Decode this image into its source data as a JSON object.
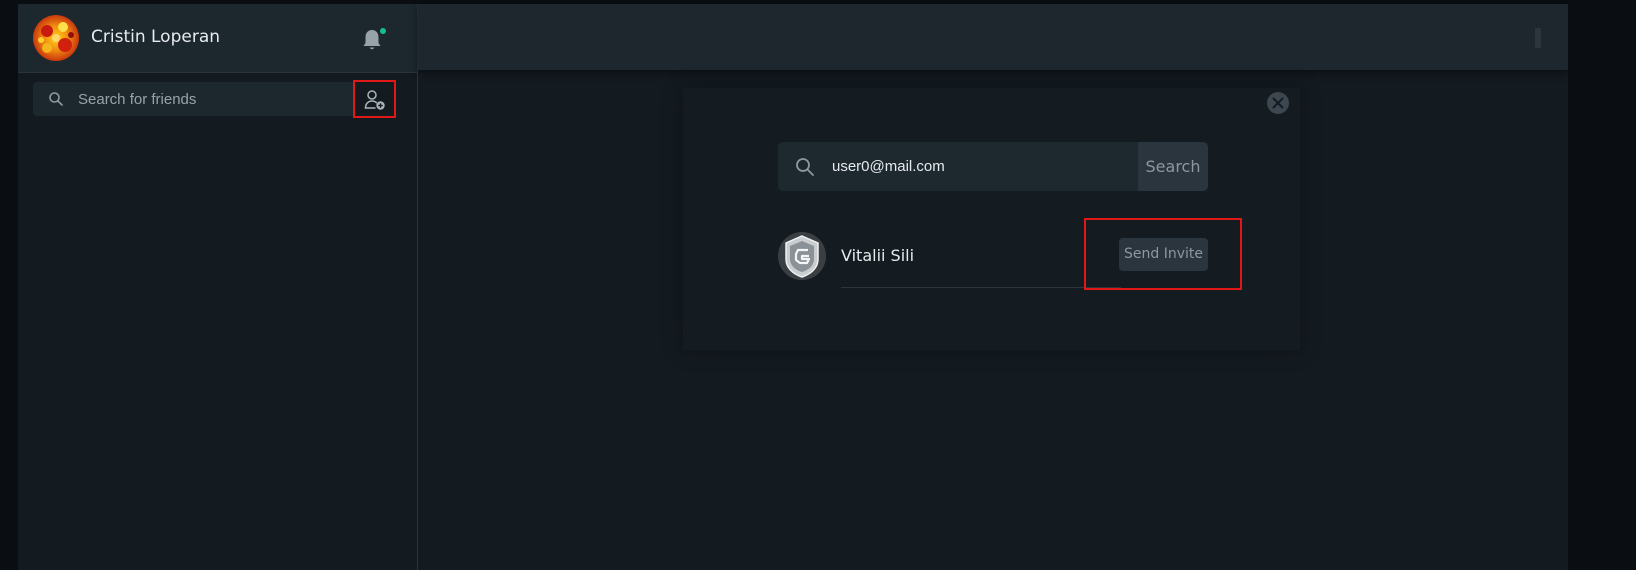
{
  "user": {
    "name": "Cristin Loperan"
  },
  "sidebar": {
    "search_placeholder": "Search for friends",
    "notification_dot_color": "#17c08a"
  },
  "add_friend_modal": {
    "email_value": "user0@mail.com",
    "search_button_label": "Search",
    "result": {
      "name": "Vitalii Sili",
      "action_label": "Send Invite"
    }
  },
  "colors": {
    "highlight": "#e01818",
    "background": "#131a20",
    "panel": "#1d272e"
  }
}
